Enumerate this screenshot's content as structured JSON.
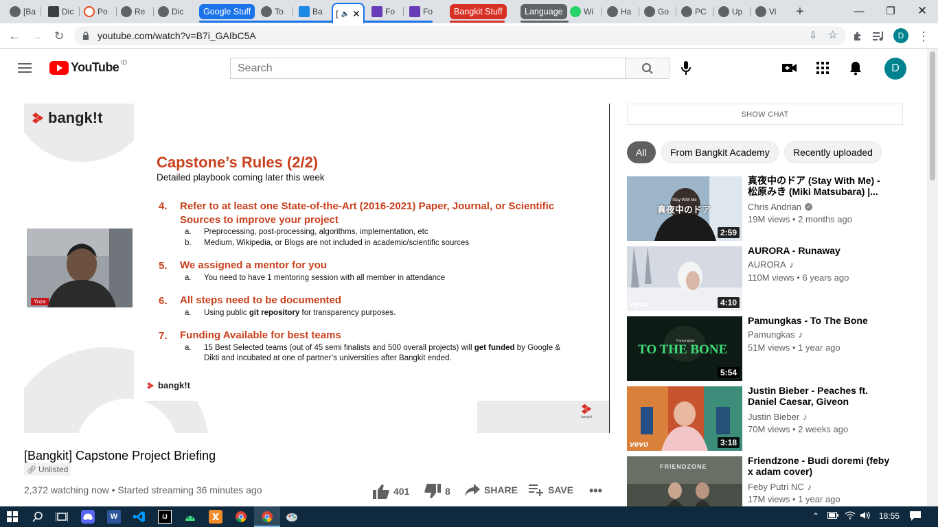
{
  "browser": {
    "tabs": [
      {
        "label": "[Ba",
        "favicon_color": "#5f6368"
      },
      {
        "label": "Dic",
        "favicon_color": "#3c4043"
      },
      {
        "label": "Po",
        "favicon_color": "#e64a19"
      },
      {
        "label": "Re",
        "favicon_color": "#5f6368"
      },
      {
        "label": "Dic",
        "favicon_color": "#5f6368"
      },
      {
        "label": "To",
        "favicon_color": "#5f6368"
      },
      {
        "label": "Ba",
        "favicon_color": "#1e88e5"
      },
      {
        "label": "[",
        "favicon_color": "#1a73e8"
      },
      {
        "label": "Fo",
        "favicon_color": "#673ab7"
      },
      {
        "label": "Fo",
        "favicon_color": "#673ab7"
      },
      {
        "label": "Wi",
        "favicon_color": "#25d366"
      },
      {
        "label": "Ha",
        "favicon_color": "#5f6368"
      },
      {
        "label": "Go",
        "favicon_color": "#5f6368"
      },
      {
        "label": "PC",
        "favicon_color": "#5f6368"
      },
      {
        "label": "Up",
        "favicon_color": "#5f6368"
      },
      {
        "label": "Vi",
        "favicon_color": "#5f6368"
      }
    ],
    "tab_groups": [
      {
        "label": "Google Stuff",
        "color": "#1a73e8"
      },
      {
        "label": "Bangkit Stuff",
        "color": "#d93025"
      },
      {
        "label": "Language",
        "color": "#5f6368"
      }
    ],
    "url": "youtube.com/watch?v=B7i_GAIbC5A",
    "profile_initial": "D"
  },
  "youtube": {
    "logo_text": "YouTube",
    "country_code": "ID",
    "search_placeholder": "Search",
    "avatar_initial": "D"
  },
  "slide": {
    "logo_text": "bangk!t",
    "title": "Capstone’s Rules (2/2)",
    "subtitle": "Detailed playbook coming later this week",
    "rules": [
      {
        "num": "4.",
        "text": "Refer to at least one State-of-the-Art (2016-2021) Paper, Journal, or Scientific Sources to improve your project",
        "bullets": [
          {
            "letter": "a.",
            "text": "Preprocessing, post-processing, algorithms, implementation, etc"
          },
          {
            "letter": "b.",
            "text": "Medium, Wikipedia, or Blogs are not included in academic/scientific sources"
          }
        ]
      },
      {
        "num": "5.",
        "text": "We assigned a mentor for you",
        "bullets": [
          {
            "letter": "a.",
            "text": "You need to have 1 mentoring session with all member in attendance"
          }
        ]
      },
      {
        "num": "6.",
        "text": "All steps need to be documented",
        "bullets": [
          {
            "letter": "a.",
            "pre": "Using public ",
            "bold": "git repository",
            "post": " for transparency purposes."
          }
        ]
      },
      {
        "num": "7.",
        "text": "Funding Available for best teams",
        "bullets": [
          {
            "letter": "a.",
            "pre": "15 Best Selected teams (out of 45 semi finalists and 500 overall projects) will ",
            "bold": "get funded",
            "post": " by Google & Dikti and incubated at one of partner’s universities after Bangkit ended."
          }
        ]
      }
    ],
    "webcam_name": "Yoza",
    "footer_logo_text": "bangk!t",
    "corner_logo_text": "bangkit"
  },
  "video": {
    "title": "[Bangkit] Capstone Project Briefing",
    "badge": "Unlisted",
    "view_info": "2,372 watching now • Started streaming 36 minutes ago",
    "likes": "401",
    "dislikes": "8",
    "share_label": "SHARE",
    "save_label": "SAVE"
  },
  "sidebar": {
    "show_chat_label": "SHOW CHAT",
    "chips": [
      "All",
      "From Bangkit Academy",
      "Recently uploaded"
    ],
    "recommendations": [
      {
        "title": "真夜中のドア (Stay With Me) - 松原みき (Miki Matsubara) |...",
        "channel": "Chris Andrian",
        "meta": "19M views • 2 months ago",
        "duration": "2:59",
        "thumb_text": "真夜中のドア",
        "thumb_small": "Stay With Me",
        "badge": "verified"
      },
      {
        "title": "AURORA - Runaway",
        "channel": "AURORA",
        "meta": "110M views • 6 years ago",
        "duration": "4:10",
        "vevo": "vevo",
        "badge": "music"
      },
      {
        "title": "Pamungkas - To The Bone",
        "channel": "Pamungkas",
        "meta": "51M views • 1 year ago",
        "duration": "5:54",
        "thumb_text": "TO THE BONE",
        "thumb_small": "Pamungkas",
        "badge": "music"
      },
      {
        "title": "Justin Bieber - Peaches ft. Daniel Caesar, Giveon",
        "channel": "Justin Bieber",
        "meta": "70M views • 2 weeks ago",
        "duration": "3:18",
        "vevo": "vevo",
        "badge": "music"
      },
      {
        "title": "Friendzone - Budi doremi (feby x adam cover)",
        "channel": "Feby Putri NC",
        "meta": "17M views • 1 year ago",
        "thumb_text": "FRIENDZONE",
        "badge": "music"
      }
    ]
  },
  "taskbar": {
    "time": "18:55",
    "word_letter": "W",
    "intellij_letter": "IJ"
  }
}
